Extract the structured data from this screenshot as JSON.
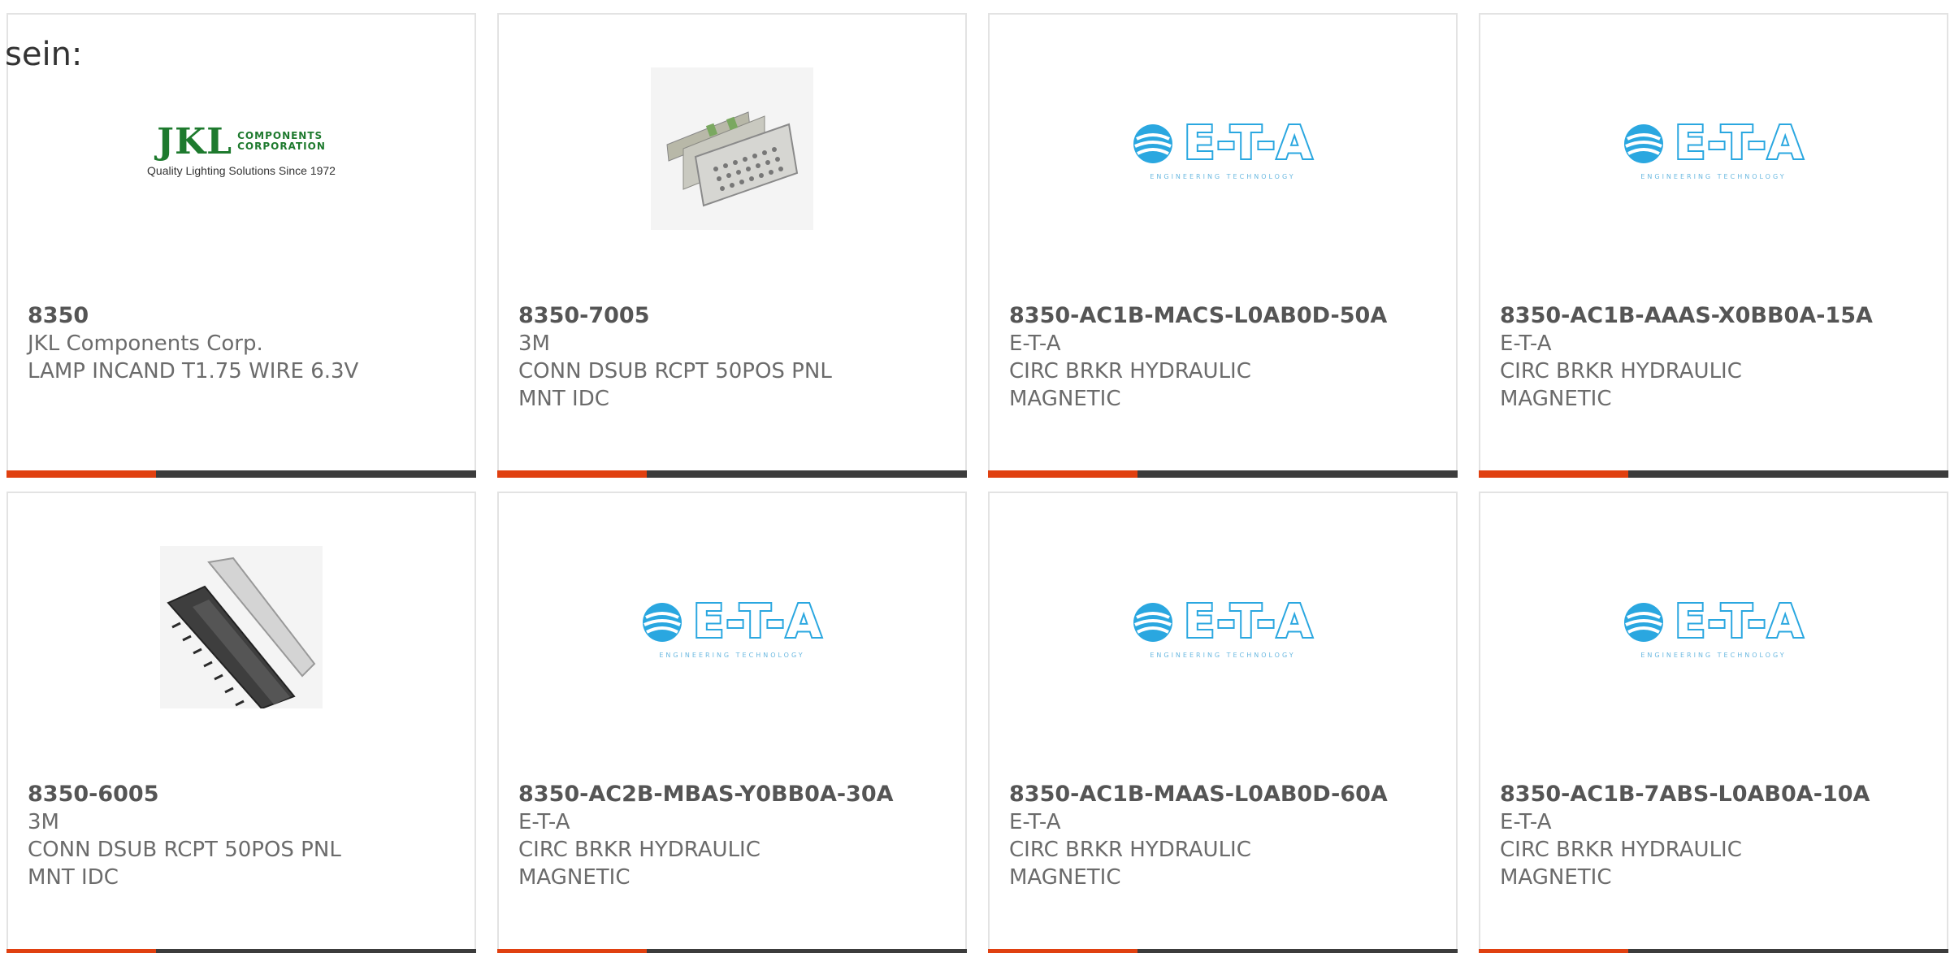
{
  "intro_text": "sein:",
  "brand": {
    "accent_color": "#e04010",
    "bar_color": "#3c3c3c",
    "eta_color": "#2aa7e0",
    "jkl_color": "#1e7a2e"
  },
  "logos": {
    "eta": {
      "word": "E-T-A",
      "tag": "ENGINEERING TECHNOLOGY"
    },
    "jkl": {
      "big": "JKL",
      "line1": "COMPONENTS",
      "line2": "CORPORATION",
      "slogan": "Quality Lighting Solutions Since 1972"
    }
  },
  "products": [
    {
      "part_number": "8350",
      "manufacturer": "JKL Components Corp.",
      "desc_line1": "LAMP INCAND T1.75 WIRE 6.3V",
      "desc_line2": "",
      "image": "jkl-logo"
    },
    {
      "part_number": "8350-7005",
      "manufacturer": "3M",
      "desc_line1": "CONN DSUB RCPT 50POS PNL",
      "desc_line2": "MNT IDC",
      "image": "dsub-connector-photo"
    },
    {
      "part_number": "8350-AC1B-MACS-L0AB0D-50A",
      "manufacturer": "E-T-A",
      "desc_line1": "CIRC BRKR HYDRAULIC",
      "desc_line2": "MAGNETIC",
      "image": "eta-logo"
    },
    {
      "part_number": "8350-AC1B-AAAS-X0BB0A-15A",
      "manufacturer": "E-T-A",
      "desc_line1": "CIRC BRKR HYDRAULIC",
      "desc_line2": "MAGNETIC",
      "image": "eta-logo"
    },
    {
      "part_number": "8350-6005",
      "manufacturer": "3M",
      "desc_line1": "CONN DSUB RCPT 50POS PNL",
      "desc_line2": "MNT IDC",
      "image": "idc-connector-photo"
    },
    {
      "part_number": "8350-AC2B-MBAS-Y0BB0A-30A",
      "manufacturer": "E-T-A",
      "desc_line1": "CIRC BRKR HYDRAULIC",
      "desc_line2": "MAGNETIC",
      "image": "eta-logo"
    },
    {
      "part_number": "8350-AC1B-MAAS-L0AB0D-60A",
      "manufacturer": "E-T-A",
      "desc_line1": "CIRC BRKR HYDRAULIC",
      "desc_line2": "MAGNETIC",
      "image": "eta-logo"
    },
    {
      "part_number": "8350-AC1B-7ABS-L0AB0A-10A",
      "manufacturer": "E-T-A",
      "desc_line1": "CIRC BRKR HYDRAULIC",
      "desc_line2": "MAGNETIC",
      "image": "eta-logo"
    }
  ]
}
